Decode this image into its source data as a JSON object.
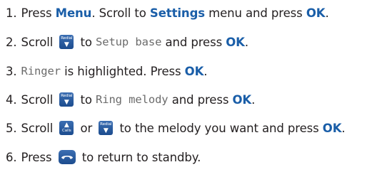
{
  "steps": [
    {
      "num": "1.",
      "t1": "Press ",
      "k1": "Menu",
      "t2": ". Scroll to ",
      "k2": "Settings",
      "t3": " menu and press ",
      "k3": "OK",
      "t4": "."
    },
    {
      "num": "2.",
      "t1": "Scroll ",
      "key_label": "Redial",
      "t2": " to ",
      "lcd": "Setup base",
      "t3": " and press ",
      "k1": "OK",
      "t4": "."
    },
    {
      "num": "3.",
      "lcd": "Ringer",
      "t1": " is highlighted. Press ",
      "k1": "OK",
      "t2": "."
    },
    {
      "num": "4.",
      "t1": "Scroll ",
      "key_label": "Redial",
      "t2": " to ",
      "lcd": "Ring melody",
      "t3": " and press ",
      "k1": "OK",
      "t4": "."
    },
    {
      "num": "5.",
      "t1": "Scroll ",
      "key1_label": "Calls",
      "t2": " or ",
      "key2_label": "Redial",
      "t3": " to the melody you want and press ",
      "k1": "OK",
      "t4": "."
    },
    {
      "num": "6.",
      "t1": "Press ",
      "t2": " to return to standby."
    }
  ],
  "icons": {
    "scroll_down": "redial-down-key-icon",
    "scroll_up": "calls-up-key-icon",
    "end_call": "end-call-key-icon"
  },
  "colors": {
    "keyword": "#1a5ea8",
    "key": "#2a5ea0",
    "lcd_text": "#6b6b6b",
    "text": "#231f20"
  }
}
